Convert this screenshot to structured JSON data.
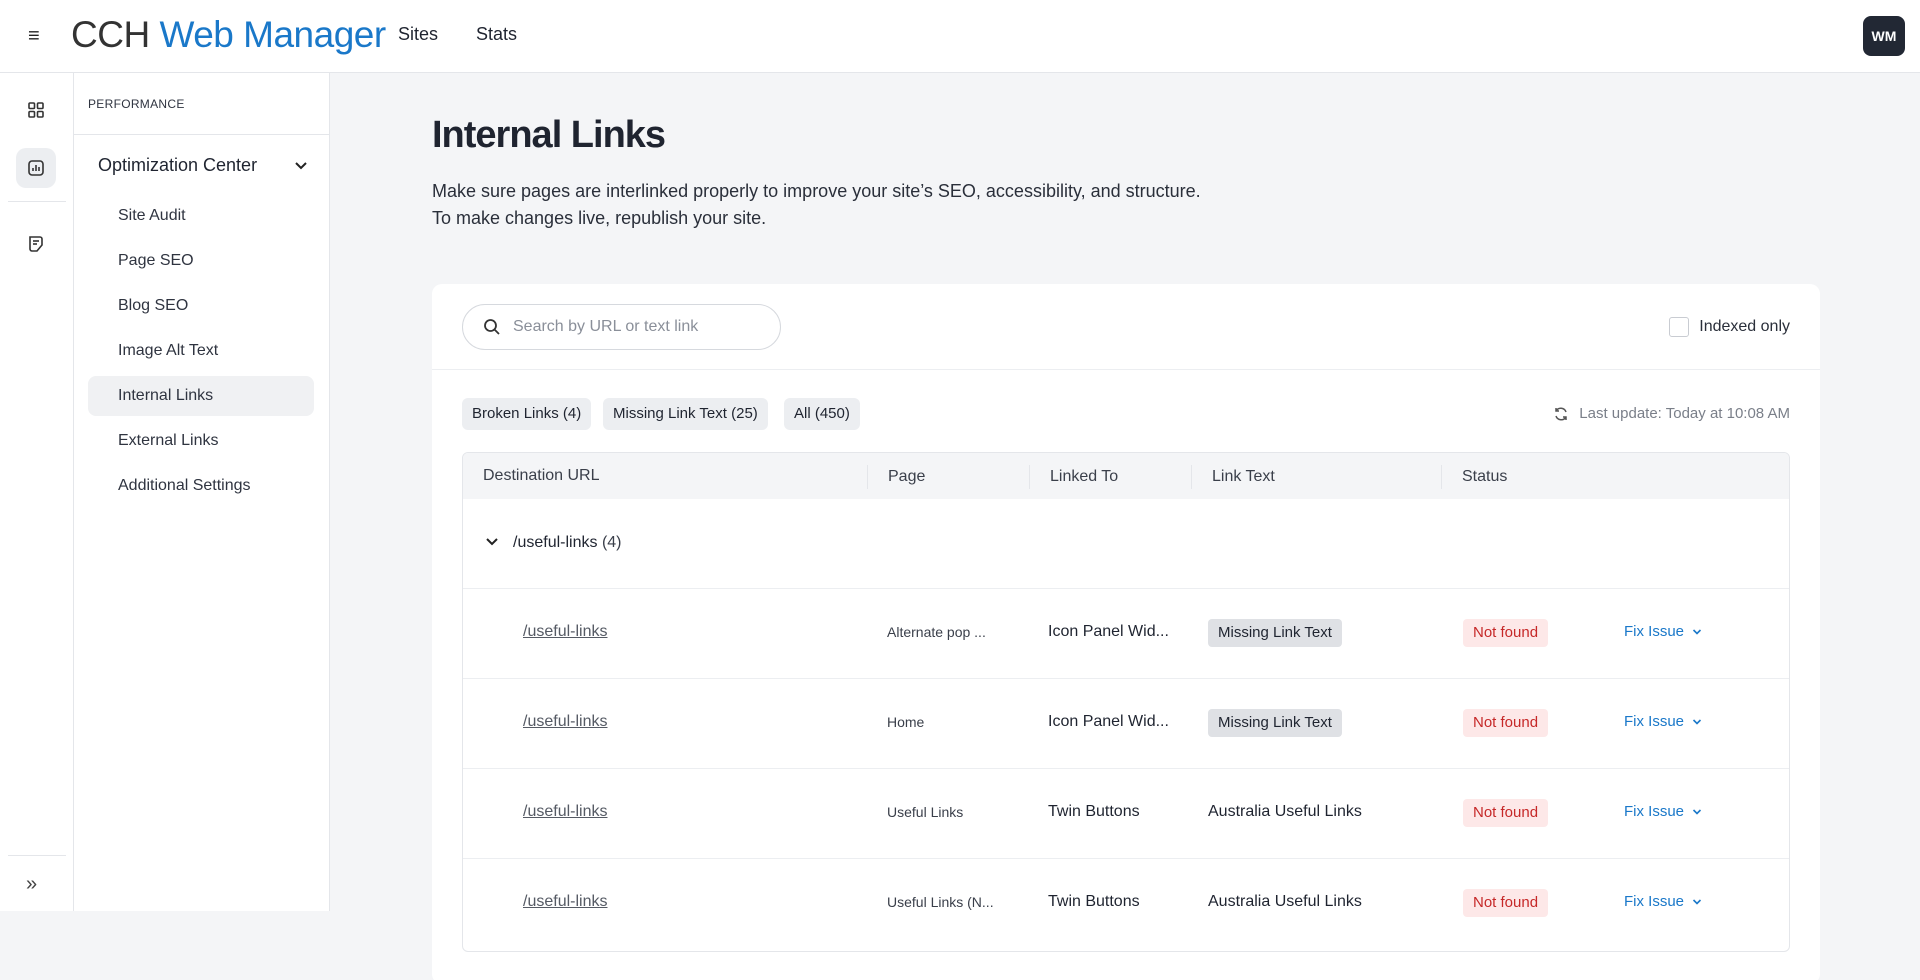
{
  "app": {
    "brand_part1": "CCH",
    "brand_part2": "Web Manager",
    "nav": [
      "Sites",
      "Stats"
    ],
    "avatar_initials": "WM"
  },
  "rail": {
    "icons": [
      "dashboard-icon",
      "analytics-icon",
      "notes-icon",
      "expand-icon"
    ]
  },
  "sidebar": {
    "section_label": "PERFORMANCE",
    "group_label": "Optimization Center",
    "items": [
      {
        "label": "Site Audit",
        "active": false
      },
      {
        "label": "Page SEO",
        "active": false
      },
      {
        "label": "Blog SEO",
        "active": false
      },
      {
        "label": "Image Alt Text",
        "active": false
      },
      {
        "label": "Internal Links",
        "active": true
      },
      {
        "label": "External Links",
        "active": false
      },
      {
        "label": "Additional Settings",
        "active": false
      }
    ]
  },
  "main": {
    "title": "Internal Links",
    "desc_line1": "Make sure pages are interlinked properly to improve your site’s SEO, accessibility, and structure.",
    "desc_line2": "To make changes live, republish your site.",
    "search_placeholder": "Search by URL or text link",
    "indexed_label": "Indexed only",
    "filters": [
      "Broken Links (4)",
      "Missing Link Text (25)",
      "All (450)"
    ],
    "last_update": "Last update: Today at 10:08 AM",
    "columns": [
      "Destination URL",
      "Page",
      "Linked To",
      "Link Text",
      "Status"
    ],
    "group": {
      "title": "/useful-links",
      "count": "(4)"
    },
    "rows": [
      {
        "url": "/useful-links",
        "page": "Alternate pop ...",
        "linked_to": "Icon Panel Wid...",
        "link_text": "Missing Link Text",
        "link_text_is_tag": true,
        "status": "Not found",
        "action": "Fix Issue"
      },
      {
        "url": "/useful-links",
        "page": "Home",
        "linked_to": "Icon Panel Wid...",
        "link_text": "Missing Link Text",
        "link_text_is_tag": true,
        "status": "Not found",
        "action": "Fix Issue"
      },
      {
        "url": "/useful-links",
        "page": "Useful Links",
        "linked_to": "Twin Buttons",
        "link_text": "Australia Useful Links",
        "link_text_is_tag": false,
        "status": "Not found",
        "action": "Fix Issue"
      },
      {
        "url": "/useful-links",
        "page": "Useful Links (N...",
        "linked_to": "Twin Buttons",
        "link_text": "Australia Useful Links",
        "link_text_is_tag": false,
        "status": "Not found",
        "action": "Fix Issue"
      }
    ]
  },
  "colors": {
    "brand_blue": "#1a78c9",
    "status_red": "#c62828",
    "status_red_bg": "#fde8e8"
  }
}
